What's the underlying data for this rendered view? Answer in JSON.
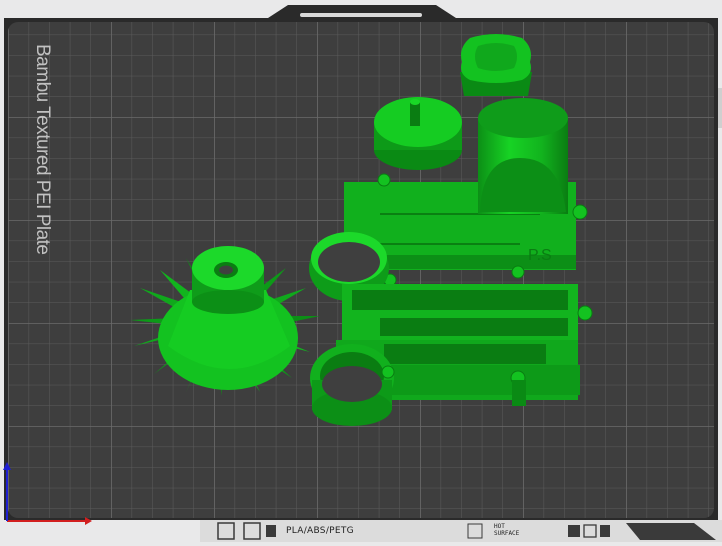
{
  "plate": {
    "label": "Bambu Textured PEI Plate",
    "material_label": "PLA/ABS/PETG",
    "surface_line1": "HOT",
    "surface_line2": "SURFACE"
  },
  "part_text": {
    "engraving": "P.S"
  },
  "colors": {
    "plate": "#3e3e3e",
    "grid": "#5c5c5c",
    "model": "#12c21f",
    "model_dark": "#0a7d12",
    "frame": "#2a2a2a",
    "x_axis": "#d21f1f",
    "y_axis": "#1f1fd2"
  }
}
